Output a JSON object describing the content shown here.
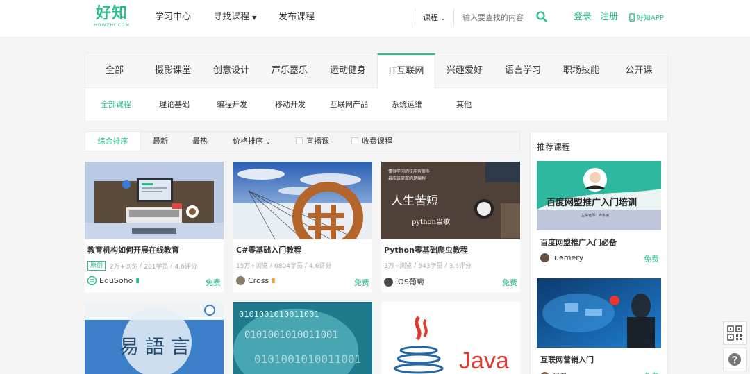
{
  "header": {
    "logo_main": "好知",
    "logo_sub": "HOWZHI.COM",
    "nav": [
      {
        "label": "学习中心"
      },
      {
        "label": "寻找课程"
      },
      {
        "label": "发布课程"
      }
    ],
    "search": {
      "category": "课程",
      "placeholder": "输入要查找的内容"
    },
    "login": "登录",
    "register": "注册",
    "app": "好知APP"
  },
  "categories": {
    "tabs": [
      "全部",
      "摄影课堂",
      "创意设计",
      "声乐器乐",
      "运动健身",
      "IT互联网",
      "兴趣爱好",
      "语言学习",
      "职场技能",
      "公开课"
    ],
    "active_tab": "IT互联网",
    "sub_tabs": [
      "全部课程",
      "理论基础",
      "编程开发",
      "移动开发",
      "互联网产品",
      "系统运维",
      "其他"
    ],
    "active_sub": "全部课程"
  },
  "sort": {
    "items": [
      "综合排序",
      "最新",
      "最热",
      "价格排序"
    ],
    "checks": [
      "直播课",
      "收费课程"
    ]
  },
  "courses": [
    {
      "title": "教育机构如何开展在线教育",
      "badge": "原创",
      "views": "2万+浏览",
      "students": "201学员",
      "rating": "4.6评分",
      "user": "EduSoho",
      "price": "免费"
    },
    {
      "title": "C#零基础入门教程",
      "views": "15万+浏览",
      "students": "6804学员",
      "rating": "4.6评分",
      "user": "Cross",
      "price": "免费"
    },
    {
      "title": "Python零基础爬虫教程",
      "views": "3万+浏览",
      "students": "543学员",
      "rating": "3.6评分",
      "user": "iOS葡萄",
      "price": "免费"
    }
  ],
  "image_text": {
    "python_quote_1": "懂得学习的技能有很多",
    "python_quote_2": "最应该掌握的是编程",
    "python_big": "人生苦短",
    "python_sub": "python当歌",
    "yiyu": "易 語 言",
    "java": "Java",
    "binary": "0101001010011001"
  },
  "recommend": {
    "title": "推荐课程",
    "items": [
      {
        "banner": "百度网盟推广入门培训",
        "banner_sub": "主讲老师：卢永丽",
        "name": "百度网盟推广入门必备",
        "user": "luemery",
        "price": "免费"
      },
      {
        "name": "互联网营销入门",
        "user": "阿丑",
        "price": "免费"
      }
    ]
  },
  "colors": {
    "brand": "#29c08a"
  }
}
